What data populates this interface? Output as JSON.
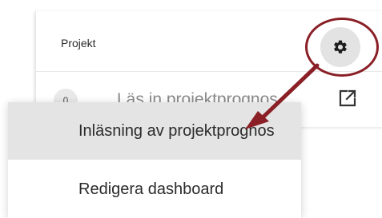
{
  "widget": {
    "title": "Projekt",
    "row": {
      "count": "0",
      "label": "Läs in projektprognos"
    }
  },
  "menu": {
    "items": [
      {
        "label": "Inläsning av projektprognos",
        "state": "hover"
      },
      {
        "label": "Redigera dashboard"
      }
    ]
  },
  "icons": {
    "settings": "gear-icon",
    "open_external": "external-link-icon"
  },
  "colors": {
    "annotation": "#8a1f26",
    "hover_background": "#e4e4e4",
    "gear_background": "#e3e3e3"
  }
}
